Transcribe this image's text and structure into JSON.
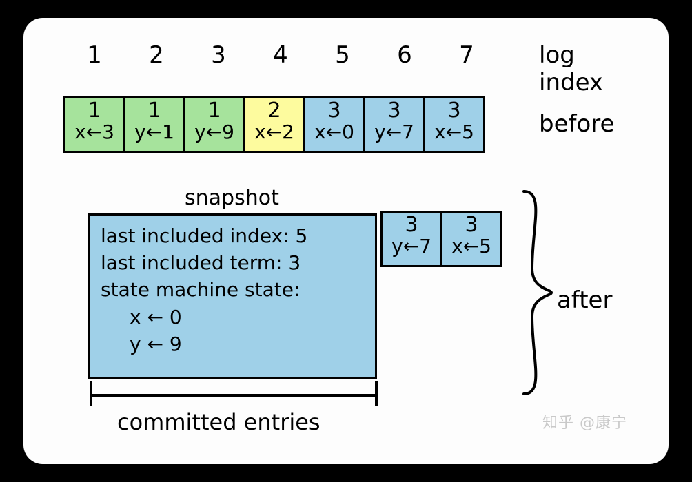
{
  "header": {
    "indices": [
      "1",
      "2",
      "3",
      "4",
      "5",
      "6",
      "7"
    ],
    "index_label": "log index"
  },
  "before": {
    "label": "before",
    "entries": [
      {
        "term": "1",
        "cmd": "x←3",
        "color": "g"
      },
      {
        "term": "1",
        "cmd": "y←1",
        "color": "g"
      },
      {
        "term": "1",
        "cmd": "y←9",
        "color": "g"
      },
      {
        "term": "2",
        "cmd": "x←2",
        "color": "y"
      },
      {
        "term": "3",
        "cmd": "x←0",
        "color": "b"
      },
      {
        "term": "3",
        "cmd": "y←7",
        "color": "b"
      },
      {
        "term": "3",
        "cmd": "x←5",
        "color": "b"
      }
    ]
  },
  "snapshot": {
    "title": "snapshot",
    "l1": "last included index: 5",
    "l2": "last included term: 3",
    "l3": "state machine state:",
    "l4": "x ← 0",
    "l5": "y ← 9"
  },
  "after": {
    "label": "after",
    "entries": [
      {
        "term": "3",
        "cmd": "y←7",
        "color": "b"
      },
      {
        "term": "3",
        "cmd": "x←5",
        "color": "b"
      }
    ]
  },
  "committed_label": "committed entries",
  "watermark": "知乎 @康宁"
}
